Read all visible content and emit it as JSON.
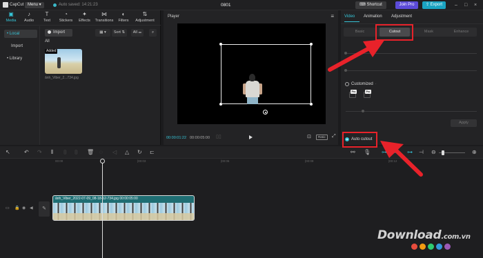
{
  "topbar": {
    "logo_text": "CapCut",
    "menu_label": "Menu",
    "autosave_text": "Auto saved: 14:21:23",
    "project_title": "0801",
    "shortcut_label": "Shortcut",
    "joinpro_label": "Join Pro",
    "export_label": "Export"
  },
  "media_tabs": [
    {
      "label": "Media",
      "icon": "media-icon"
    },
    {
      "label": "Audio",
      "icon": "audio-icon"
    },
    {
      "label": "Text",
      "icon": "text-icon"
    },
    {
      "label": "Stickers",
      "icon": "stickers-icon"
    },
    {
      "label": "Effects",
      "icon": "effects-icon"
    },
    {
      "label": "Transitions",
      "icon": "transitions-icon"
    },
    {
      "label": "Filters",
      "icon": "filters-icon"
    },
    {
      "label": "Adjustment",
      "icon": "adjustment-icon"
    }
  ],
  "side_nav": {
    "local": "• Local",
    "import": "Import",
    "library": "• Library"
  },
  "media": {
    "import_label": "Import",
    "sort_label": "Sort",
    "all_filter": "All",
    "section_label": "All",
    "clip_badge": "Added",
    "clip_name": "ảnh_Viber_2...734.jpg"
  },
  "player": {
    "title": "Player",
    "current_time": "00:00:01:22",
    "total_time": "00:00:05:00",
    "ratio_label": "Ratio"
  },
  "inspector": {
    "tabs": [
      "Video",
      "Animation",
      "Adjustment"
    ],
    "subtabs": [
      "Basic",
      "Cutout",
      "Mask",
      "Enhance"
    ],
    "customized_label": "Customized",
    "pro_badge": "Pro",
    "apply_label": "Apply",
    "auto_cutout_label": "Auto cutout"
  },
  "timeline": {
    "ruler_labels": [
      "00:00",
      "|00:03",
      "|00:06",
      "|00:09",
      "|00:12"
    ],
    "clip_label": "ảnh_Viber_2022-07-09_08-18-52-734.jpg    00:00:05:00",
    "cover_label": "Cover"
  },
  "watermark": {
    "text": "Download",
    "suffix": ".com.vn",
    "dot_colors": [
      "#e84c3d",
      "#f39c12",
      "#2ecc71",
      "#3498db",
      "#9b59b6"
    ]
  },
  "colors": {
    "accent": "#36c5d8",
    "annotation_red": "#e8222a",
    "join_pro": "#5b4bd8",
    "export": "#1aa4c2"
  }
}
